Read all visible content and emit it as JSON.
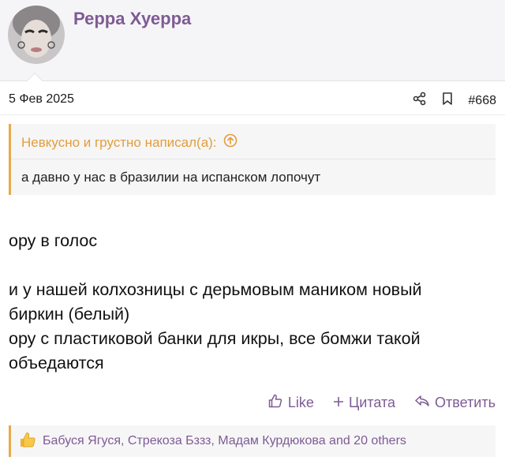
{
  "user": {
    "name": "Реppa Хуеppa"
  },
  "post": {
    "date": "5 Фев 2025",
    "number": "#668",
    "quote": {
      "author_line": "Невкусно и грустно написал(а):",
      "text": "а давно у нас в бразилии на испанском лопочут"
    },
    "body": {
      "line1": "ору в голос",
      "line2": "и у нашей колхозницы с дерьмовым маником новый",
      "line3": "биркин (белый)",
      "line4": "ору с пластиковой банки для икры, все бомжи такой",
      "line5": "объедаются"
    }
  },
  "reactions": {
    "like_label": "Like",
    "quote_label": "Цитата",
    "reply_label": "Ответить"
  },
  "likes_summary": "Бабуся Ягуся, Стрекоза Бззз, Мадам Курдюкова and 20 others",
  "colors": {
    "accent": "#7e5b94",
    "quote_border": "#e9a94a"
  }
}
